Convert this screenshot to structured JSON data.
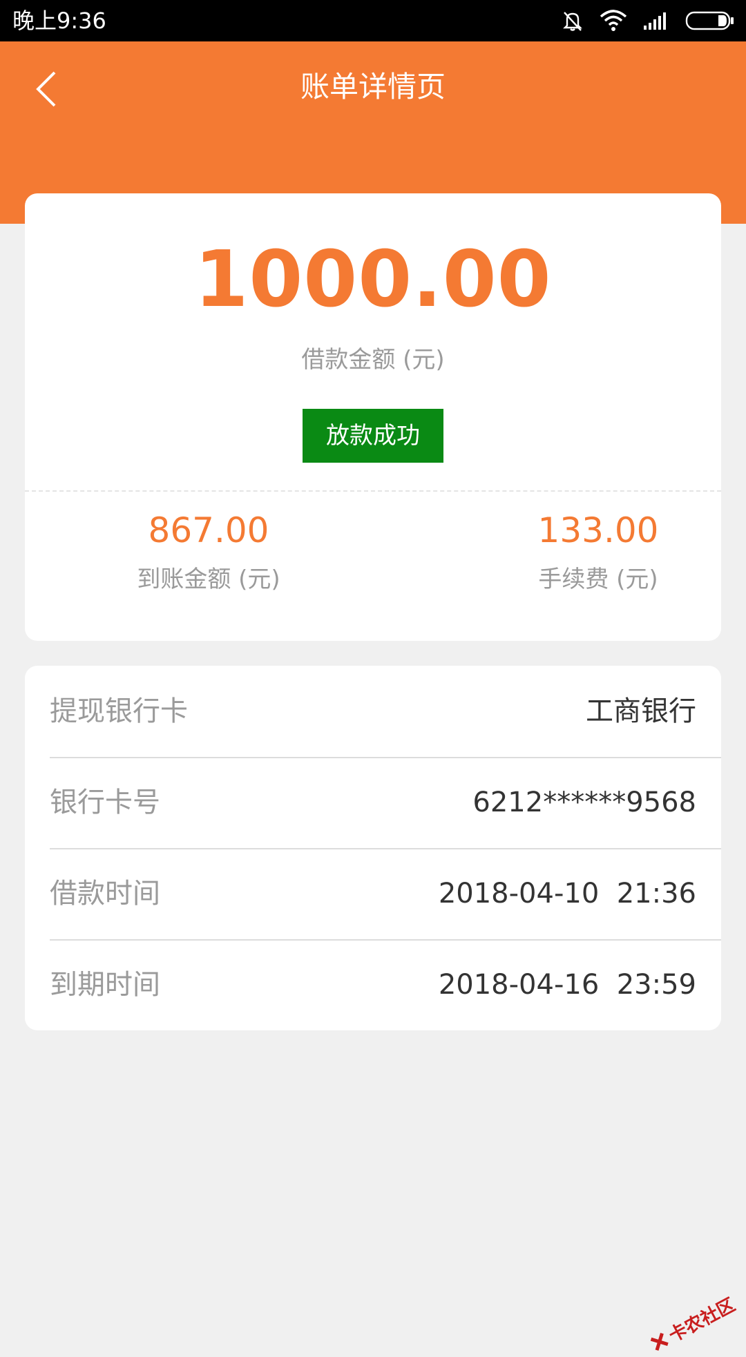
{
  "status_bar": {
    "time": "晚上9:36",
    "icons": [
      "bell-muted-icon",
      "wifi-icon",
      "signal-icon",
      "battery-icon"
    ]
  },
  "header": {
    "title": "账单详情页",
    "back_icon": "chevron-left-icon"
  },
  "summary": {
    "amount": "1000.00",
    "amount_label": "借款金额 (元)",
    "status_badge": "放款成功",
    "received": {
      "value": "867.00",
      "label": "到账金额 (元)"
    },
    "fee": {
      "value": "133.00",
      "label": "手续费 (元)"
    }
  },
  "details": {
    "rows": [
      {
        "label": "提现银行卡",
        "value": "工商银行"
      },
      {
        "label": "银行卡号",
        "value": "6212******9568"
      },
      {
        "label": "借款时间",
        "value": "2018-04-10  21:36"
      },
      {
        "label": "到期时间",
        "value": "2018-04-16  23:59"
      }
    ]
  },
  "watermark": {
    "text": "卡农社区"
  },
  "colors": {
    "accent": "#f47a33",
    "success": "#0a8a14",
    "background": "#f0f0f0"
  }
}
